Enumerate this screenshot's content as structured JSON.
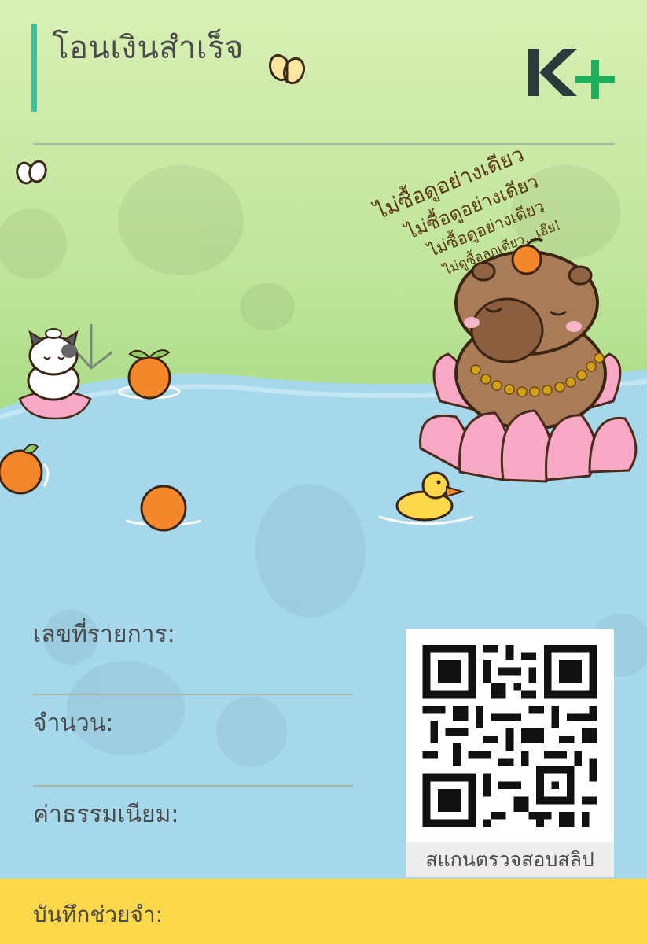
{
  "header": {
    "title": "โอนเงินสำเร็จ"
  },
  "logo": {
    "text": "K",
    "plus": "+",
    "colors": {
      "k": "#2b3a3a",
      "plus": "#1fae5a"
    }
  },
  "illustration": {
    "handwriting": [
      "ไม่ซื้อดูอย่างเดียว",
      "ไม่ซื้อดูอย่างเดียว",
      "ไม่ซื้อดูอย่างเดียว",
      "ไม่ดูซื้อลูกเดียว...เอ๊ย!"
    ]
  },
  "fields": {
    "transaction_id": "เลขที่รายการ:",
    "amount": "จำนวน:",
    "fee": "ค่าธรรมเนียม:"
  },
  "qr": {
    "caption": "สแกนตรวจสอบสลิป"
  },
  "memo": {
    "label": "บันทึกช่วยจำ:"
  },
  "colors": {
    "accent": "#3dbfa1",
    "memo_bar": "#fdd84a",
    "text": "#4a4a4a"
  }
}
